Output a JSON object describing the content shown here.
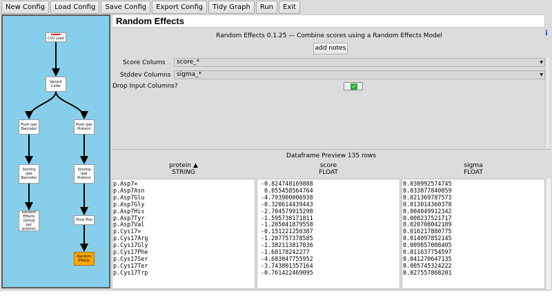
{
  "toolbar": [
    "New Config",
    "Load Config",
    "Save Config",
    "Export Config",
    "Tidy Graph",
    "Run",
    "Exit"
  ],
  "graph": {
    "nodes": {
      "csv_load": "CSV Load",
      "variant_caller": "Variant Caller",
      "pivot_barcode": "Pivot (per Barcode)",
      "pivot_protein": "Pivot (per Protein)",
      "scoring_barcode": "Scoring (per Barcode)",
      "scoring_protein": "Scoring (per Protein)",
      "random_effects_group": "Random Effects (Group per protein)",
      "pivot_tool": "Pivot Tool",
      "random_effects": "Random Effects"
    }
  },
  "config": {
    "title": "Random Effects",
    "info": "i",
    "subtitle": "Random Effects 0.1.25 — Combine scores using a Random Effects Model",
    "add_notes": "add notes",
    "score_label": "Score Colums",
    "score_value": "score_*",
    "stddev_label": "Stddev Columns",
    "stddev_value": "sigma_*",
    "drop_label": "Drop Input Columns?",
    "drop_checked": true
  },
  "preview": {
    "title": "Dataframe Preview 135 rows",
    "columns": [
      {
        "name": "protein",
        "type": "STRING",
        "sort": "▲"
      },
      {
        "name": "score",
        "type": "FLOAT"
      },
      {
        "name": "sigma",
        "type": "FLOAT"
      }
    ],
    "protein": [
      "p.Asp7=",
      "p.Asp7Asn",
      "p.Asp7Glu",
      "p.Asp7Gly",
      "p.Asp7His",
      "p.Asp7Tyr",
      "p.Asp7Val",
      "p.Cys17=",
      "p.Cys17Arg",
      "p.Cys17Gly",
      "p.Cys17Phe",
      "p.Cys17Ser",
      "p.Cys17Ter",
      "p.Cys17Trp"
    ],
    "score": [
      "-0.824748169888",
      " 0.055458564764",
      "-4.793900006938",
      "-0.320614439443",
      "-2.704579915298",
      "-1.595738171811",
      "-1.205041879558",
      "-0.151221250387",
      "-1.207757378585",
      "-1.382113817036",
      "-1.68178242277",
      "-4.683047755952",
      "-3.743801357164",
      "-0.761422469095"
    ],
    "sigma": [
      "0.030992574745",
      "0.033877840059",
      "0.021369787573",
      "0.013014360378",
      "0.004049912342",
      "0.008237521717",
      "0.020708042189",
      "0.016217880775",
      "0.014097852145",
      "0.009857008405",
      "0.011637754597",
      "0.041270647135",
      "0.005745324222",
      "0.027557868201"
    ]
  },
  "colors": {
    "graph_bg": "#87ceeb",
    "selected_node": "#ffa500",
    "check": "#2fa83a"
  }
}
